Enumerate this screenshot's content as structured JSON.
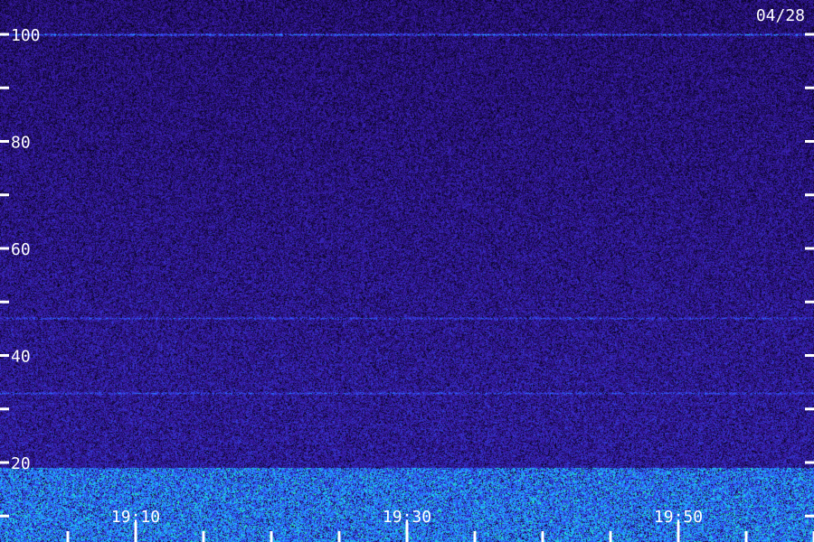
{
  "date_label": "04/28",
  "chart_data": {
    "type": "heatmap",
    "title": "",
    "xlabel": "",
    "ylabel": "",
    "x_tick_labels": [
      "19:10",
      "19:30",
      "19:50"
    ],
    "x_major_ticks": [
      "19:10",
      "19:30",
      "19:50"
    ],
    "x_minor_tick_count_between_labels": 3,
    "y_tick_labels": [
      "100",
      "80",
      "60",
      "40",
      "20"
    ],
    "y_ticks": [
      100,
      90,
      80,
      70,
      60,
      50,
      40,
      30,
      20,
      10
    ],
    "ylim": [
      10,
      105
    ],
    "xlim": [
      "19:05",
      "19:55"
    ],
    "features": [
      {
        "kind": "horizontal_line",
        "y": 100,
        "intensity": "medium",
        "color": "#3f6dff"
      },
      {
        "kind": "horizontal_line",
        "y": 33,
        "intensity": "low",
        "color": "#3b62ff"
      },
      {
        "kind": "horizontal_line",
        "y": 47,
        "intensity": "low",
        "color": "#3552e6"
      },
      {
        "kind": "band",
        "y_range": [
          10,
          19
        ],
        "intensity": "high",
        "color": "#2cf58a"
      }
    ],
    "colormap": [
      "#000000",
      "#1a0a55",
      "#3a1aa8",
      "#2f55ff",
      "#1ad0ff",
      "#2cf58a"
    ]
  }
}
